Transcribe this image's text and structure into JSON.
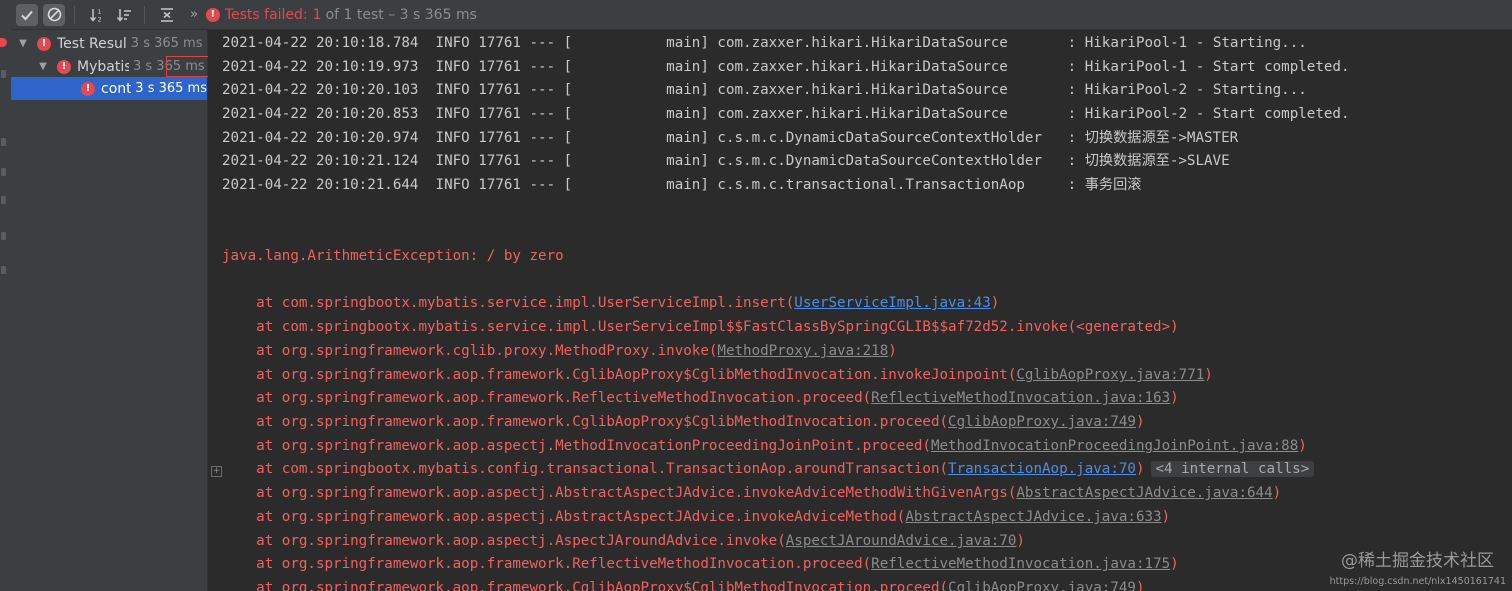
{
  "toolbar": {
    "chevron": "»",
    "status_label": "Tests failed:",
    "status_count": "1",
    "status_rest": "of 1 test – 3 s 365 ms"
  },
  "tree": {
    "rows": [
      {
        "name": "Test Resul",
        "time": "3 s 365 ms"
      },
      {
        "name": "Mybatis",
        "time": "3 s 365 ms"
      },
      {
        "name": "cont",
        "time": "3 s 365 ms"
      }
    ]
  },
  "console": {
    "logs": [
      "2021-04-22 20:10:18.784  INFO 17761 --- [           main] com.zaxxer.hikari.HikariDataSource       : HikariPool-1 - Starting...",
      "2021-04-22 20:10:19.973  INFO 17761 --- [           main] com.zaxxer.hikari.HikariDataSource       : HikariPool-1 - Start completed.",
      "2021-04-22 20:10:20.103  INFO 17761 --- [           main] com.zaxxer.hikari.HikariDataSource       : HikariPool-2 - Starting...",
      "2021-04-22 20:10:20.853  INFO 17761 --- [           main] com.zaxxer.hikari.HikariDataSource       : HikariPool-2 - Start completed.",
      "2021-04-22 20:10:20.974  INFO 17761 --- [           main] c.s.m.c.DynamicDataSourceContextHolder   : 切换数据源至->MASTER",
      "2021-04-22 20:10:21.124  INFO 17761 --- [           main] c.s.m.c.DynamicDataSourceContextHolder   : 切换数据源至->SLAVE",
      "2021-04-22 20:10:21.644  INFO 17761 --- [           main] c.s.m.c.transactional.TransactionAop     : 事务回滚"
    ],
    "exception": "java.lang.ArithmeticException: / by zero",
    "trace": [
      {
        "pre": "    at com.springbootx.mybatis.service.impl.UserServiceImpl.insert(",
        "link": "UserServiceImpl.java:43",
        "link_color": "blue",
        "post": ")"
      },
      {
        "pre": "    at com.springbootx.mybatis.service.impl.UserServiceImpl$$FastClassBySpringCGLIB$$af72d52.invoke(<generated>)",
        "link": "",
        "link_color": "",
        "post": ""
      },
      {
        "pre": "    at org.springframework.cglib.proxy.MethodProxy.invoke(",
        "link": "MethodProxy.java:218",
        "link_color": "gray",
        "post": ")"
      },
      {
        "pre": "    at org.springframework.aop.framework.CglibAopProxy$CglibMethodInvocation.invokeJoinpoint(",
        "link": "CglibAopProxy.java:771",
        "link_color": "gray",
        "post": ")"
      },
      {
        "pre": "    at org.springframework.aop.framework.ReflectiveMethodInvocation.proceed(",
        "link": "ReflectiveMethodInvocation.java:163",
        "link_color": "gray",
        "post": ")"
      },
      {
        "pre": "    at org.springframework.aop.framework.CglibAopProxy$CglibMethodInvocation.proceed(",
        "link": "CglibAopProxy.java:749",
        "link_color": "gray",
        "post": ")"
      },
      {
        "pre": "    at org.springframework.aop.aspectj.MethodInvocationProceedingJoinPoint.proceed(",
        "link": "MethodInvocationProceedingJoinPoint.java:88",
        "link_color": "gray",
        "post": ")"
      },
      {
        "pre": "    at com.springbootx.mybatis.config.transactional.TransactionAop.aroundTransaction(",
        "link": "TransactionAop.java:70",
        "link_color": "blue",
        "post": ")",
        "calls": "<4 internal calls>"
      },
      {
        "pre": "    at org.springframework.aop.aspectj.AbstractAspectJAdvice.invokeAdviceMethodWithGivenArgs(",
        "link": "AbstractAspectJAdvice.java:644",
        "link_color": "gray",
        "post": ")"
      },
      {
        "pre": "    at org.springframework.aop.aspectj.AbstractAspectJAdvice.invokeAdviceMethod(",
        "link": "AbstractAspectJAdvice.java:633",
        "link_color": "gray",
        "post": ")"
      },
      {
        "pre": "    at org.springframework.aop.aspectj.AspectJAroundAdvice.invoke(",
        "link": "AspectJAroundAdvice.java:70",
        "link_color": "gray",
        "post": ")"
      },
      {
        "pre": "    at org.springframework.aop.framework.ReflectiveMethodInvocation.proceed(",
        "link": "ReflectiveMethodInvocation.java:175",
        "link_color": "gray",
        "post": ")"
      },
      {
        "pre": "    at org.springframework.aop.framework.CglibAopProxy$CglibMethodInvocation.proceed(",
        "link": "CglibAopProxy.java:749",
        "link_color": "gray",
        "post": ")"
      }
    ]
  },
  "watermark": {
    "brand": "@稀土掘金技术社区",
    "url": "https://blog.csdn.net/nlx1450161741"
  },
  "colors": {
    "error": "#e5484d",
    "selection": "#2f65ca",
    "link_blue": "#4d8fe6",
    "trace_red": "#f0625f"
  },
  "icons": [
    "check-icon",
    "stop-icon",
    "sort-alpha-icon",
    "sort-duration-icon",
    "collapse-all-icon",
    "error-icon",
    "chevron-down-icon"
  ]
}
